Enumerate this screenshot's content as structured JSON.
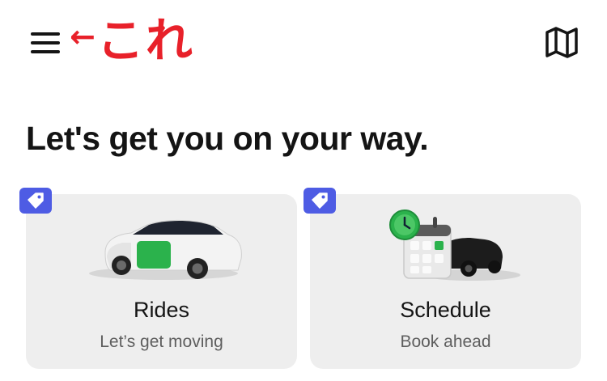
{
  "header": {
    "annotation_arrow": "←",
    "annotation_text": "これ"
  },
  "main": {
    "headline": "Let's get you on your way.",
    "cards": [
      {
        "title": "Rides",
        "subtitle": "Let’s get moving"
      },
      {
        "title": "Schedule",
        "subtitle": "Book ahead"
      }
    ]
  },
  "icons": {
    "menu": "hamburger-menu-icon",
    "map": "map-icon",
    "promo": "tag-icon"
  },
  "colors": {
    "accent": "#4e5ce4",
    "annotation": "#e8212a",
    "card_bg": "#eeeeee",
    "car_green": "#2bb24c"
  }
}
